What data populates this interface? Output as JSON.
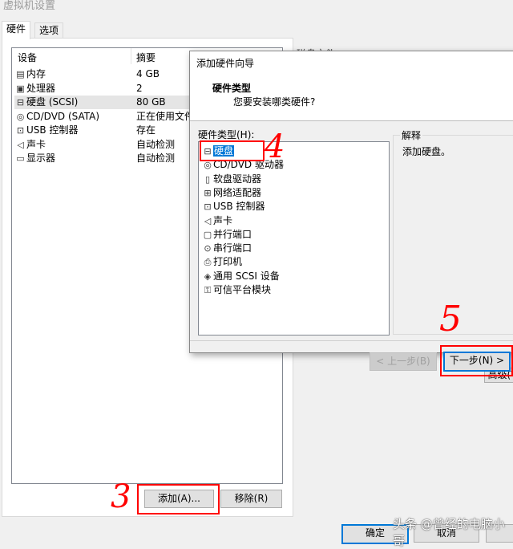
{
  "window": {
    "title": "虚拟机设置",
    "tabs": [
      {
        "label": "硬件",
        "active": true
      },
      {
        "label": "选项",
        "active": false
      }
    ]
  },
  "device_table": {
    "headers": [
      "设备",
      "摘要"
    ],
    "rows": [
      {
        "icon": "memory-icon",
        "glyph": "▤",
        "device": "内存",
        "summary": "4 GB",
        "selected": false
      },
      {
        "icon": "processor-icon",
        "glyph": "▣",
        "device": "处理器",
        "summary": "2",
        "selected": false
      },
      {
        "icon": "hard-disk-icon",
        "glyph": "⊟",
        "device": "硬盘 (SCSI)",
        "summary": "80 GB",
        "selected": true
      },
      {
        "icon": "cd-dvd-icon",
        "glyph": "◎",
        "device": "CD/DVD (SATA)",
        "summary": "正在使用文件",
        "selected": false
      },
      {
        "icon": "usb-icon",
        "glyph": "⊡",
        "device": "USB 控制器",
        "summary": "存在",
        "selected": false
      },
      {
        "icon": "sound-icon",
        "glyph": "◁",
        "device": "声卡",
        "summary": "自动检测",
        "selected": false
      },
      {
        "icon": "display-icon",
        "glyph": "▭",
        "device": "显示器",
        "summary": "自动检测",
        "selected": false
      }
    ]
  },
  "buttons": {
    "add": "添加(A)...",
    "remove": "移除(R)",
    "ok": "确定",
    "cancel": "取消",
    "advanced": "高级(V"
  },
  "right_pane": {
    "disk_file_label": "磁盘文件"
  },
  "wizard": {
    "title": "添加硬件向导",
    "heading": "硬件类型",
    "subheading": "您要安装哪类硬件?",
    "list_label": "硬件类型(H):",
    "explain_label": "解释",
    "explain_text": "添加硬盘。",
    "hardware_types": [
      {
        "icon": "hard-disk-icon",
        "glyph": "⊟",
        "label": "硬盘",
        "selected": true
      },
      {
        "icon": "cd-dvd-icon",
        "glyph": "◎",
        "label": "CD/DVD 驱动器",
        "selected": false
      },
      {
        "icon": "floppy-icon",
        "glyph": "▯",
        "label": "软盘驱动器",
        "selected": false
      },
      {
        "icon": "network-adapter-icon",
        "glyph": "⊞",
        "label": "网络适配器",
        "selected": false
      },
      {
        "icon": "usb-icon",
        "glyph": "⊡",
        "label": "USB 控制器",
        "selected": false
      },
      {
        "icon": "sound-icon",
        "glyph": "◁",
        "label": "声卡",
        "selected": false
      },
      {
        "icon": "parallel-port-icon",
        "glyph": "▢",
        "label": "并行端口",
        "selected": false
      },
      {
        "icon": "serial-port-icon",
        "glyph": "⊙",
        "label": "串行端口",
        "selected": false
      },
      {
        "icon": "printer-icon",
        "glyph": "⎙",
        "label": "打印机",
        "selected": false
      },
      {
        "icon": "scsi-device-icon",
        "glyph": "◈",
        "label": "通用 SCSI 设备",
        "selected": false
      },
      {
        "icon": "tpm-icon",
        "glyph": "⚿",
        "label": "可信平台模块",
        "selected": false
      }
    ],
    "back_button": "< 上一步(B)",
    "next_button": "下一步(N) >"
  },
  "annotations": {
    "step3": "3",
    "step4": "4",
    "step5": "5",
    "color": "#ff0000"
  },
  "watermark": "头条 @曾经的电脑小哥"
}
